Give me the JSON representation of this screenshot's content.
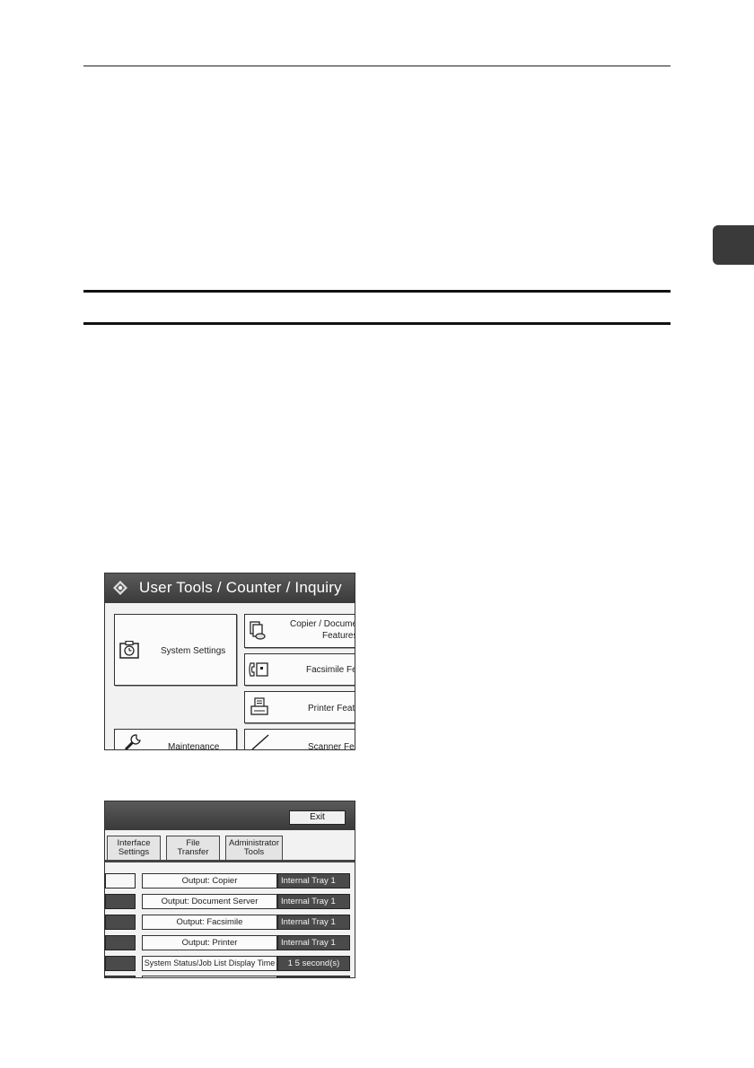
{
  "screen1": {
    "title": "User Tools / Counter / Inquiry",
    "buttons": {
      "system_settings": "System Settings",
      "copier_line1": "Copier / Document",
      "copier_line2": "Features",
      "facsimile": "Facsimile Feat",
      "printer": "Printer Featu",
      "maintenance": "Maintenance",
      "scanner": "Scanner Featu"
    }
  },
  "screen2": {
    "exit_label": "Exit",
    "tabs": [
      {
        "line1": "Interface",
        "line2": "Settings"
      },
      {
        "line1": "File",
        "line2": "Transfer"
      },
      {
        "line1": "Administrator",
        "line2": "Tools"
      }
    ],
    "rows": [
      {
        "label": "Output: Copier",
        "value": "Internal Tray 1"
      },
      {
        "label": "Output: Document Server",
        "value": "Internal Tray 1"
      },
      {
        "label": "Output: Facsimile",
        "value": "Internal Tray 1"
      },
      {
        "label": "Output: Printer",
        "value": "Internal Tray 1"
      },
      {
        "label": "System Status/Job List Display Time",
        "value": "1 5 second(s)"
      }
    ]
  }
}
